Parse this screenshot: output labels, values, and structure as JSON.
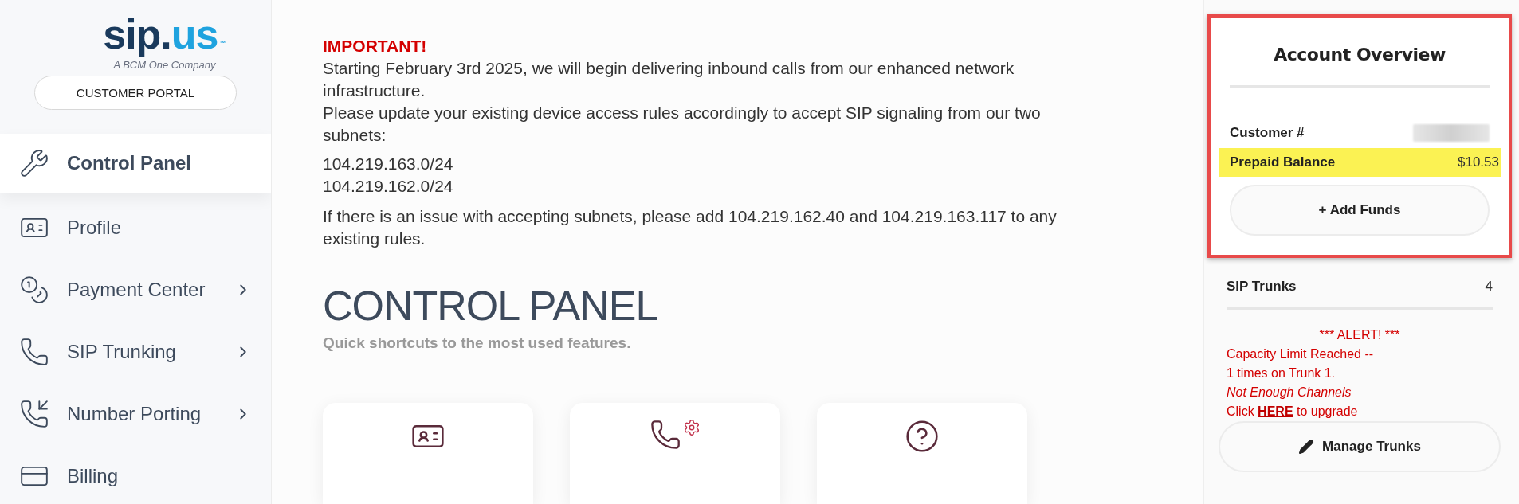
{
  "logo": {
    "dark_part": "sip.",
    "light_part": "us",
    "trademark": "™",
    "tagline": "A BCM One Company"
  },
  "portal_button": "CUSTOMER PORTAL",
  "sidebar": {
    "items": [
      {
        "label": "Control Panel",
        "kind": "wrench",
        "selected": true,
        "expandable": false
      },
      {
        "label": "Profile",
        "kind": "badge",
        "selected": false,
        "expandable": false
      },
      {
        "label": "Payment Center",
        "kind": "coins",
        "selected": false,
        "expandable": true
      },
      {
        "label": "SIP Trunking",
        "kind": "phone",
        "selected": false,
        "expandable": true
      },
      {
        "label": "Number Porting",
        "kind": "incoming",
        "selected": false,
        "expandable": true
      },
      {
        "label": "Billing",
        "kind": "card",
        "selected": false,
        "expandable": false
      }
    ]
  },
  "notice": {
    "title": "IMPORTANT!",
    "paragraph_1": "Starting February 3rd 2025, we will begin delivering inbound calls from our enhanced network infrastructure.",
    "paragraph_2": "Please update your existing device access rules accordingly to accept SIP signaling from our two subnets:",
    "subnets": [
      "104.219.163.0/24",
      "104.219.162.0/24"
    ],
    "paragraph_3": "If there is an issue with accepting subnets, please add 104.219.162.40 and 104.219.163.117 to any existing rules."
  },
  "page": {
    "title": "CONTROL PANEL",
    "subtitle": "Quick shortcuts to the most used features."
  },
  "shortcut_cards": [
    {
      "kind": "badge"
    },
    {
      "kind": "settings"
    },
    {
      "kind": "help"
    }
  ],
  "account_overview": {
    "title": "Account Overview",
    "customer_label": "Customer #",
    "balance_label": "Prepaid Balance",
    "balance_value": "$10.53",
    "add_funds_button": "+ Add Funds"
  },
  "trunks": {
    "label": "SIP Trunks",
    "count": "4"
  },
  "alert": {
    "heading": "*** ALERT! ***",
    "line_1": "Capacity Limit Reached --",
    "line_2": "1 times on Trunk 1.",
    "line_3": "Not Enough Channels",
    "upgrade_prefix": "Click ",
    "upgrade_link": "HERE",
    "upgrade_suffix": " to upgrade"
  },
  "manage_trunks_button": "Manage Trunks"
}
